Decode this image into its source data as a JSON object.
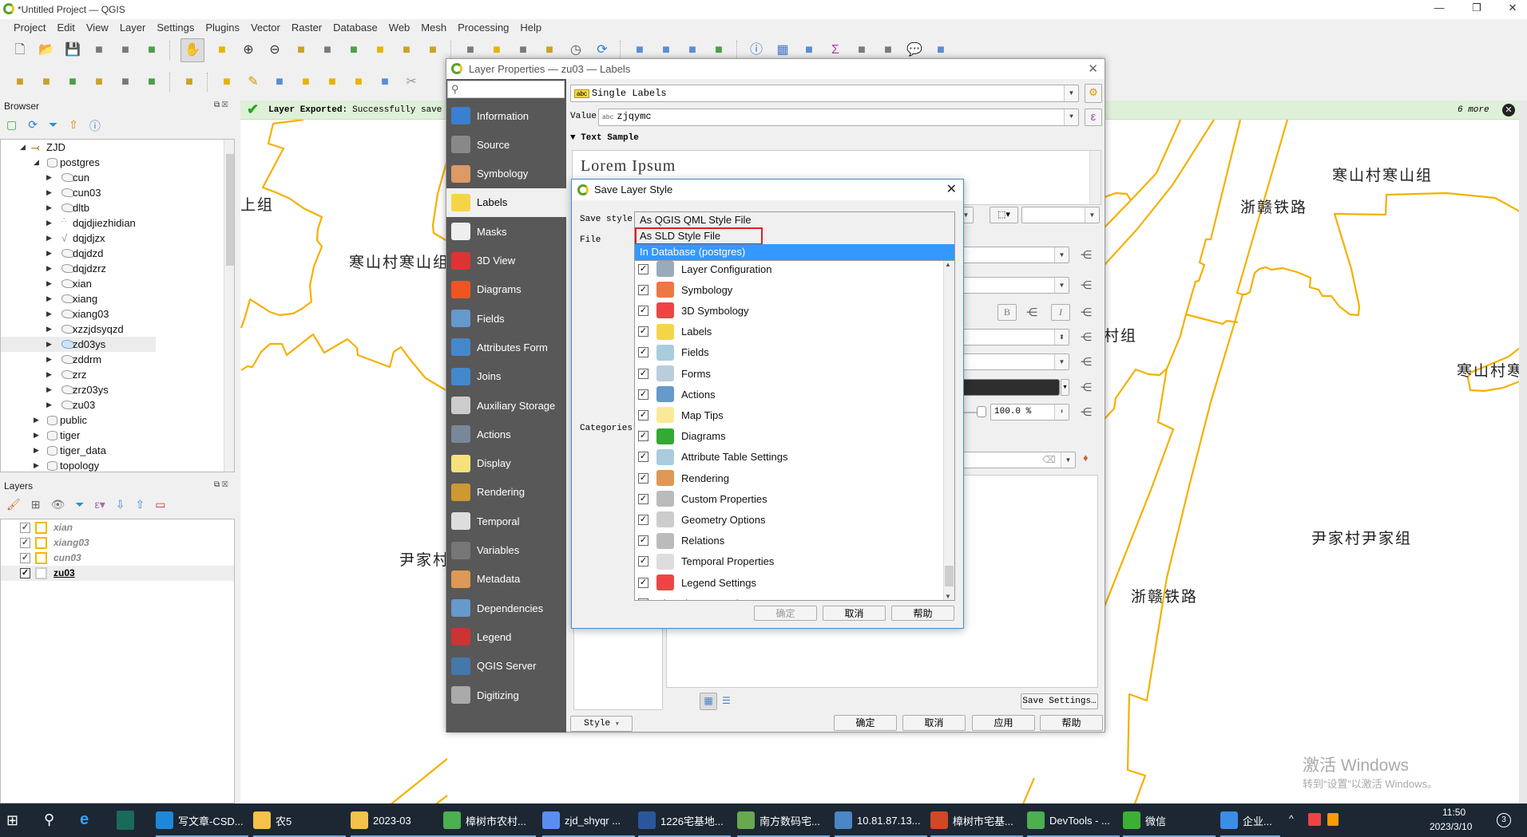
{
  "window": {
    "title": "*Untitled Project — QGIS",
    "minimize": "—",
    "restore": "❐",
    "close": "✕"
  },
  "menu": [
    "Project",
    "Edit",
    "View",
    "Layer",
    "Settings",
    "Plugins",
    "Vector",
    "Raster",
    "Database",
    "Web",
    "Mesh",
    "Processing",
    "Help"
  ],
  "toolbar1": [
    "new-project",
    "open-project",
    "save-project",
    "save-as",
    "print-layout",
    "style-manager",
    "sep",
    "pan",
    "pan-to-selection",
    "zoom-in",
    "zoom-out",
    "zoom-full",
    "zoom-to-selection",
    "zoom-to-layer",
    "zoom-native",
    "zoom-last",
    "zoom-next",
    "sep",
    "new-map-view",
    "new-3d-view",
    "new-bookmark",
    "show-bookmarks",
    "temporal-controller",
    "refresh",
    "sep",
    "select-features",
    "select-by-value",
    "select-location",
    "deselect",
    "sep",
    "identify",
    "attribute-table",
    "statistics",
    "sum",
    "measure",
    "measure-area",
    "map-tips",
    "style-dock"
  ],
  "toolbar2": [
    "data-source-manager",
    "new-geopackage",
    "new-shapefile",
    "new-spatialite",
    "new-virtual-layer",
    "new-mesh",
    "sep",
    "new-temporary-layer",
    "sep",
    "edit-toggle",
    "pencil",
    "save-edits",
    "add-feature",
    "vertex-tool",
    "digitize-options",
    "delete-selected",
    "cut-features"
  ],
  "browser": {
    "title": "Browser",
    "tree": [
      {
        "label": "ZJD",
        "level": 0,
        "expanded": true,
        "icon": "postgis-connection"
      },
      {
        "label": "postgres",
        "level": 1,
        "expanded": true,
        "icon": "schema"
      },
      {
        "label": "cun",
        "level": 2,
        "icon": "polygon"
      },
      {
        "label": "cun03",
        "level": 2,
        "icon": "polygon"
      },
      {
        "label": "dltb",
        "level": 2,
        "icon": "polygon"
      },
      {
        "label": "dqjdjiezhidian",
        "level": 2,
        "icon": "point"
      },
      {
        "label": "dqjdjzx",
        "level": 2,
        "icon": "line"
      },
      {
        "label": "dqjdzd",
        "level": 2,
        "icon": "polygon"
      },
      {
        "label": "dqjdzrz",
        "level": 2,
        "icon": "polygon"
      },
      {
        "label": "xian",
        "level": 2,
        "icon": "polygon"
      },
      {
        "label": "xiang",
        "level": 2,
        "icon": "polygon"
      },
      {
        "label": "xiang03",
        "level": 2,
        "icon": "polygon"
      },
      {
        "label": "xzzjdsyqzd",
        "level": 2,
        "icon": "polygon"
      },
      {
        "label": "zd03ys",
        "level": 2,
        "icon": "polygon",
        "selected": true
      },
      {
        "label": "zddrm",
        "level": 2,
        "icon": "polygon"
      },
      {
        "label": "zrz",
        "level": 2,
        "icon": "polygon"
      },
      {
        "label": "zrz03ys",
        "level": 2,
        "icon": "polygon"
      },
      {
        "label": "zu03",
        "level": 2,
        "icon": "polygon"
      },
      {
        "label": "public",
        "level": 1,
        "icon": "schema"
      },
      {
        "label": "tiger",
        "level": 1,
        "icon": "schema"
      },
      {
        "label": "tiger_data",
        "level": 1,
        "icon": "schema"
      },
      {
        "label": "topology",
        "level": 1,
        "icon": "schema"
      }
    ]
  },
  "layers": {
    "title": "Layers",
    "items": [
      {
        "label": "xian",
        "checked": true,
        "active": false
      },
      {
        "label": "xiang03",
        "checked": true,
        "active": false
      },
      {
        "label": "cun03",
        "checked": true,
        "active": false
      },
      {
        "label": "zu03",
        "checked": true,
        "active": true
      }
    ]
  },
  "message_bar": {
    "title": "Layer Exported:",
    "text": "Successfully save",
    "more": "6 more"
  },
  "map": {
    "line_color": "#f5b000",
    "labels": [
      "上组",
      "寒山村寒山组",
      "尹家村",
      "寒山村寒山组",
      "浙赣铁路",
      "山村组",
      "寒山村寒",
      "尹家村尹家组",
      "浙赣铁路"
    ],
    "watermark": {
      "line1": "激活 Windows",
      "line2": "转到“设置”以激活 Windows。"
    }
  },
  "layer_properties": {
    "title": "Layer Properties — zu03 — Labels",
    "sidebar": [
      "Information",
      "Source",
      "Symbology",
      "Labels",
      "Masks",
      "3D View",
      "Diagrams",
      "Fields",
      "Attributes Form",
      "Joins",
      "Auxiliary Storage",
      "Actions",
      "Display",
      "Rendering",
      "Temporal",
      "Variables",
      "Metadata",
      "Dependencies",
      "Legend",
      "QGIS Server",
      "Digitizing"
    ],
    "selected": "Labels",
    "mode": "Single Labels",
    "value_label": "Value",
    "value_type": "abc",
    "value": "zjqymc",
    "text_sample_header": "Text Sample",
    "text_sample": "Lorem Ipsum",
    "opacity": "100.0 %",
    "bold": "B",
    "italic": "I",
    "save_settings": "Save Settings…",
    "style_button": "Style",
    "buttons": {
      "ok": "确定",
      "cancel": "取消",
      "apply": "应用",
      "help": "帮助"
    }
  },
  "save_layer_style": {
    "title": "Save Layer Style",
    "save_style_label": "Save style",
    "file_label": "File",
    "categories_label": "Categories",
    "options": [
      {
        "label": "As QGIS QML Style File",
        "state": "normal"
      },
      {
        "label": "As SLD Style File",
        "state": "annotated"
      },
      {
        "label": "In Database (postgres)",
        "state": "highlighted"
      }
    ],
    "highlight_color": "#3399ff",
    "annotation_color": "#e02020",
    "categories": [
      {
        "label": "Layer Configuration",
        "checked": true
      },
      {
        "label": "Symbology",
        "checked": true
      },
      {
        "label": "3D Symbology",
        "checked": true
      },
      {
        "label": "Labels",
        "checked": true
      },
      {
        "label": "Fields",
        "checked": true
      },
      {
        "label": "Forms",
        "checked": true
      },
      {
        "label": "Actions",
        "checked": true
      },
      {
        "label": "Map Tips",
        "checked": true
      },
      {
        "label": "Diagrams",
        "checked": true
      },
      {
        "label": "Attribute Table Settings",
        "checked": true
      },
      {
        "label": "Rendering",
        "checked": true
      },
      {
        "label": "Custom Properties",
        "checked": true
      },
      {
        "label": "Geometry Options",
        "checked": true
      },
      {
        "label": "Relations",
        "checked": true
      },
      {
        "label": "Temporal Properties",
        "checked": true
      },
      {
        "label": "Legend Settings",
        "checked": true
      },
      {
        "label": "Elevation Properties",
        "checked": true
      }
    ],
    "buttons": {
      "ok": "确定",
      "ok_enabled": false,
      "cancel": "取消",
      "help": "帮助"
    }
  },
  "taskbar": {
    "items": [
      "写文章-CSD...",
      "农5",
      "2023-03",
      "樟树市农村...",
      "zjd_shyqr ...",
      "1226宅基地...",
      "南方数码宅...",
      "10.81.87.13...",
      "樟树市宅基...",
      "DevTools - ...",
      "微信",
      "企业..."
    ],
    "time": "11:50",
    "date": "2023/3/10",
    "notification_count": "3"
  }
}
